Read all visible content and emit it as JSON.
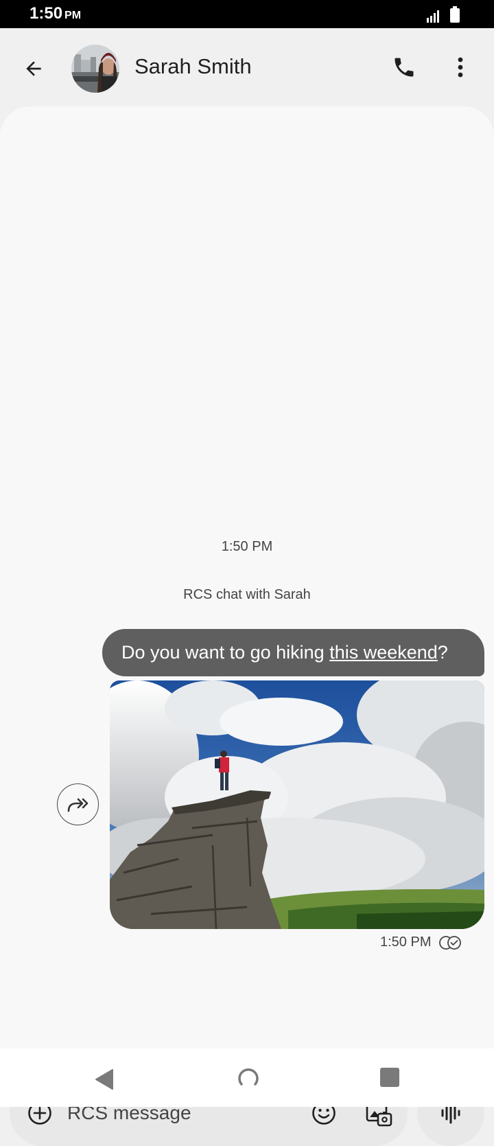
{
  "status_bar": {
    "time": "1:50",
    "ampm": "PM",
    "icons": [
      "signal-icon",
      "battery-icon"
    ]
  },
  "header": {
    "contact_name": "Sarah Smith",
    "icons": {
      "back": "arrow-left-icon",
      "call": "phone-icon",
      "more": "more-vert-icon"
    }
  },
  "chat": {
    "timestamp": "1:50 PM",
    "info": "RCS chat with Sarah",
    "message": {
      "text_before": "Do you want to go hiking ",
      "link": "this weekend",
      "text_after": "?"
    },
    "image_description_icon": "hiker-photo",
    "sent_time": "1:50 PM",
    "status_icon": "read-receipt-icon"
  },
  "compose": {
    "placeholder": "RCS message"
  },
  "colors": {
    "bubble": "#5f5f5f",
    "chat_bg": "#f8f8f8",
    "header_bg": "#f0f0f0"
  }
}
